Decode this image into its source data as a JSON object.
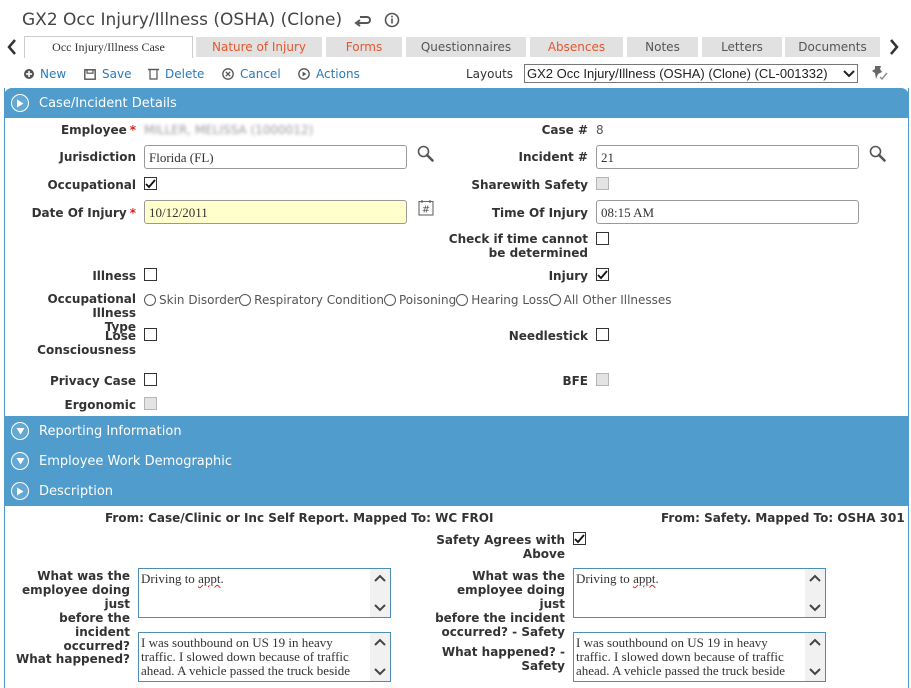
{
  "header": {
    "title": "GX2 Occ Injury/Illness (OSHA) (Clone)",
    "icons": [
      "return-icon",
      "info-icon"
    ]
  },
  "tabs": [
    {
      "label": "Occ Injury/Illness Case",
      "active": true,
      "alert": false
    },
    {
      "label": "Nature of Injury",
      "active": false,
      "alert": true
    },
    {
      "label": "Forms",
      "active": false,
      "alert": true
    },
    {
      "label": "Questionnaires",
      "active": false,
      "alert": false
    },
    {
      "label": "Absences",
      "active": false,
      "alert": true
    },
    {
      "label": "Notes",
      "active": false,
      "alert": false
    },
    {
      "label": "Letters",
      "active": false,
      "alert": false
    },
    {
      "label": "Documents",
      "active": false,
      "alert": false
    }
  ],
  "toolbar": {
    "new_label": "New",
    "save_label": "Save",
    "delete_label": "Delete",
    "cancel_label": "Cancel",
    "actions_label": "Actions",
    "layouts_label": "Layouts",
    "layouts_selected": "GX2 Occ Injury/Illness (OSHA) (Clone) (CL-001332)"
  },
  "sections": {
    "case_incident": "Case/Incident Details",
    "reporting": "Reporting Information",
    "work_demographic": "Employee Work Demographic",
    "description": "Description"
  },
  "case": {
    "employee_label": "Employee",
    "employee_value": "MILLER, MELISSA (1000012)",
    "case_no_label": "Case #",
    "case_no_value": "8",
    "jurisdiction_label": "Jurisdiction",
    "jurisdiction_value": "Florida (FL)",
    "incident_no_label": "Incident #",
    "incident_no_value": "21",
    "occupational_label": "Occupational",
    "occupational_checked": true,
    "share_safety_label": "Sharewith Safety",
    "share_safety_checked": false,
    "date_of_injury_label": "Date Of Injury",
    "date_of_injury_value": "10/12/2011",
    "time_of_injury_label": "Time Of Injury",
    "time_of_injury_value": "08:15 AM",
    "time_undetermined_label_1": "Check if time cannot",
    "time_undetermined_label_2": "be determined",
    "time_undetermined_checked": false,
    "illness_label": "Illness",
    "illness_checked": false,
    "injury_label": "Injury",
    "injury_checked": true,
    "illness_type_label_1": "Occupational Illness",
    "illness_type_label_2": "Type",
    "illness_type_options": [
      "Skin Disorder",
      "Respiratory Condition",
      "Poisoning",
      "Hearing Loss",
      "All Other Illnesses"
    ],
    "lose_consciousness_label": "Lose Consciousness",
    "lose_consciousness_checked": false,
    "needlestick_label": "Needlestick",
    "needlestick_checked": false,
    "privacy_case_label": "Privacy Case",
    "privacy_case_checked": false,
    "bfe_label": "BFE",
    "bfe_checked": false,
    "ergonomic_label": "Ergonomic",
    "ergonomic_checked": false
  },
  "description": {
    "left_header": "From: Case/Clinic or Inc Self Report. Mapped To: WC FROI",
    "right_header": "From: Safety. Mapped To: OSHA 301",
    "safety_agrees_label_1": "Safety Agrees with",
    "safety_agrees_label_2": "Above",
    "safety_agrees_checked": true,
    "doing_label": [
      "What was the",
      "employee doing just",
      "before the incident",
      "occurred?"
    ],
    "doing_value_prefix": "Driving to ",
    "doing_value_misspelled": "appt",
    "doing_value_suffix": ".",
    "doing_safety_label": [
      "What was the",
      "employee doing just",
      "before the incident",
      "occurred? - Safety"
    ],
    "happened_label": "What happened?",
    "happened_value": "I was southbound on US 19 in heavy traffic. I slowed down because of traffic ahead. A vehicle passed the truck beside",
    "happened_safety_label_1": "What happened? -",
    "happened_safety_label_2": "Safety"
  }
}
